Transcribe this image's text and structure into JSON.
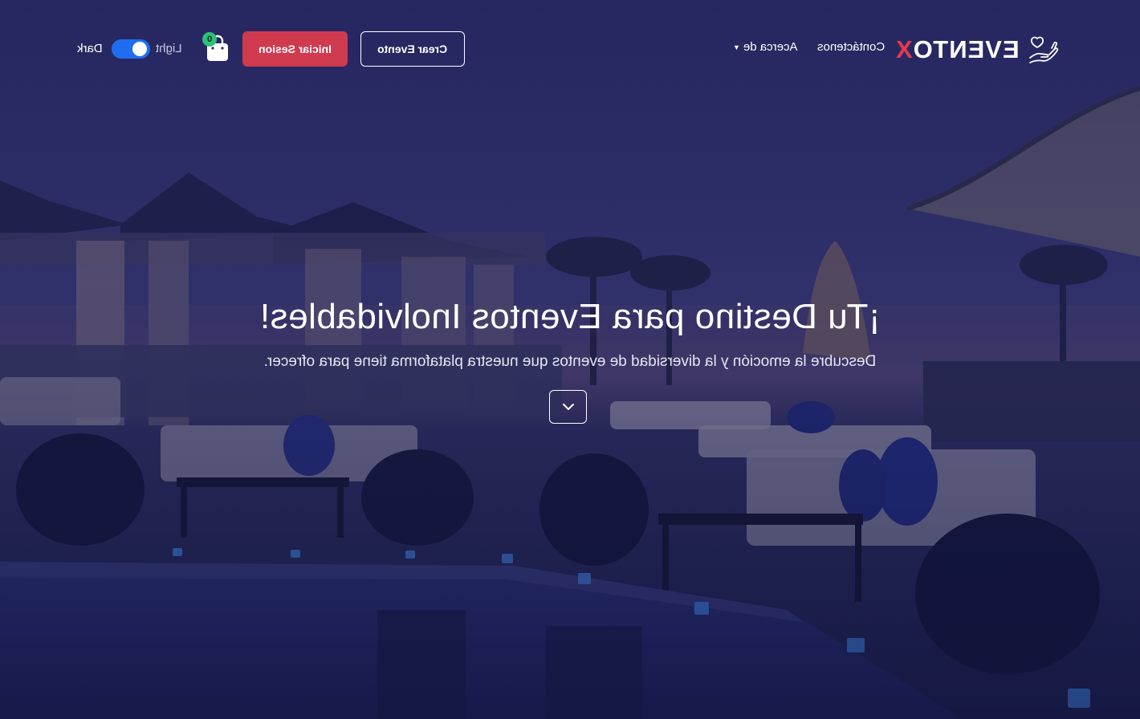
{
  "brand": {
    "name_main": "EVENTO",
    "name_accent": "X",
    "accent_color": "#e23a4c",
    "logo_icon": "hand-heart-icon"
  },
  "nav": {
    "links": [
      {
        "label": "Contáctenos"
      },
      {
        "label": "Acerca de",
        "has_dropdown": true
      }
    ]
  },
  "actions": {
    "create_event_label": "Crear Evento",
    "login_label": "Iniciar Sesion",
    "login_color": "#d03a4f",
    "cart_icon": "shopping-bag-icon",
    "cart_count": "0"
  },
  "theme": {
    "light_label": "Light",
    "dark_label": "Dark",
    "toggle_on": true,
    "toggle_color": "#1f6ef2"
  },
  "hero": {
    "title": "¡Tu Destino para Eventos Inolvidables!",
    "subtitle": "Descubre la emoción y la diversidad de eventos que nuestra plataforma tiene para ofrecer.",
    "scroll_icon": "chevron-down-icon"
  }
}
